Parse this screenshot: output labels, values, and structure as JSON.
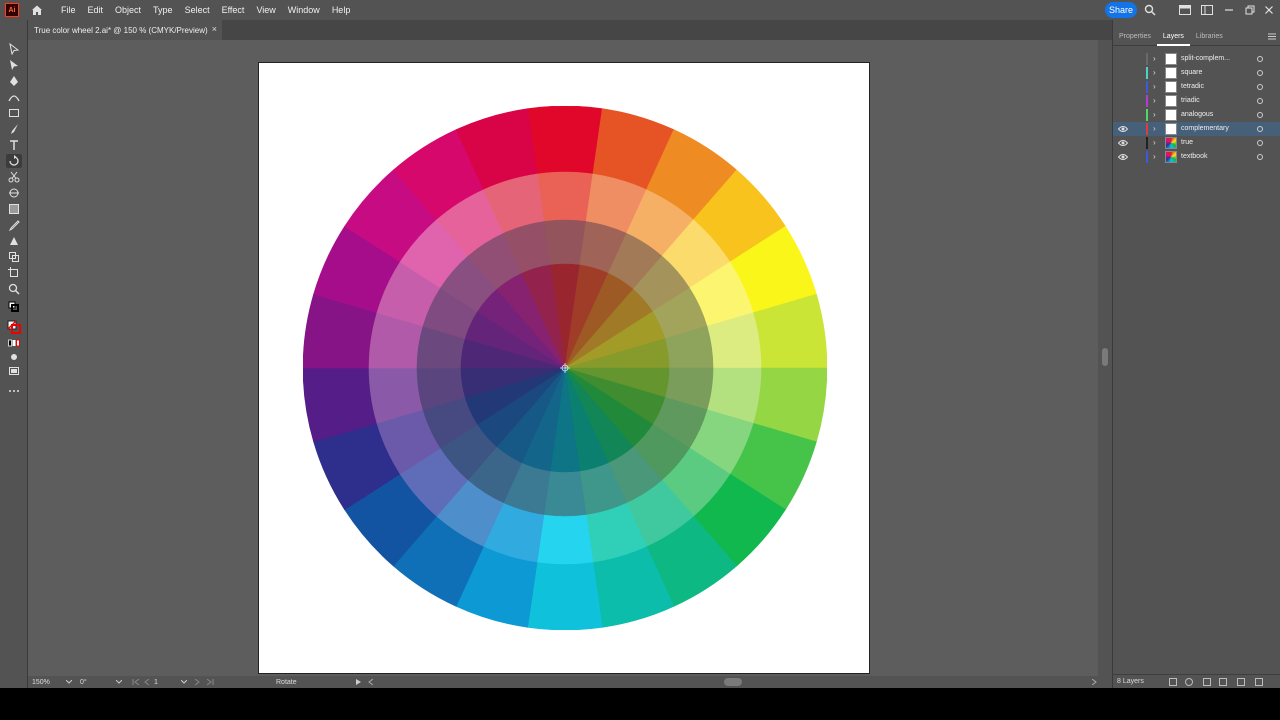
{
  "app": {
    "logo_text": "Ai",
    "menu": [
      "File",
      "Edit",
      "Object",
      "Type",
      "Select",
      "Effect",
      "View",
      "Window",
      "Help"
    ],
    "share_label": "Share"
  },
  "document": {
    "tab_title": "True color wheel 2.ai* @ 150 % (CMYK/Preview)",
    "close_glyph": "×"
  },
  "statusbar": {
    "zoom": "150%",
    "rotation": "0°",
    "artboard_number": "1",
    "tool_name": "Rotate"
  },
  "panel": {
    "tabs": [
      "Properties",
      "Layers",
      "Libraries"
    ],
    "active_tab": "Layers",
    "layers": [
      {
        "name": "split-complem...",
        "color": "#6a6a6a",
        "visible": false,
        "thumb": "blank",
        "selected": false
      },
      {
        "name": "square",
        "color": "#4fd1c5",
        "visible": false,
        "thumb": "blank",
        "selected": false
      },
      {
        "name": "tetradic",
        "color": "#3b5bdb",
        "visible": false,
        "thumb": "blank",
        "selected": false
      },
      {
        "name": "triadic",
        "color": "#b13ccf",
        "visible": false,
        "thumb": "blank",
        "selected": false
      },
      {
        "name": "analogous",
        "color": "#4cd964",
        "visible": false,
        "thumb": "blank",
        "selected": false
      },
      {
        "name": "complementary",
        "color": "#e03c3c",
        "visible": true,
        "thumb": "blank",
        "selected": true
      },
      {
        "name": "true",
        "color": "#222222",
        "visible": true,
        "thumb": "wheel",
        "selected": false
      },
      {
        "name": "textbook",
        "color": "#3b5bdb",
        "visible": true,
        "thumb": "wheel",
        "selected": false
      }
    ],
    "footer_label": "8 Layers"
  },
  "color_wheel": {
    "outer_ring": [
      "#e0072b",
      "#e65425",
      "#ef8b23",
      "#f7c31c",
      "#fbf61a",
      "#cbe536",
      "#94d643",
      "#46c449",
      "#10b84e",
      "#0db882",
      "#0cbdac",
      "#10c1dc",
      "#0d99d4",
      "#0f70b7",
      "#1354a2",
      "#2e2e8c",
      "#551d87",
      "#861487",
      "#a60d8a",
      "#c70b83",
      "#d6086c",
      "#d90448"
    ],
    "middle_ring": [
      "#e96255",
      "#ef8d63",
      "#f6b066",
      "#fadb6c",
      "#fbf56f",
      "#dcec80",
      "#b4e17f",
      "#86d57f",
      "#5acb80",
      "#40c99e",
      "#2fd0b7",
      "#25d4ee",
      "#30aadf",
      "#4e8fcb",
      "#5f6db8",
      "#6b5aa9",
      "#8a5aa8",
      "#b05aa9",
      "#c65eab",
      "#e063ad",
      "#e5639a",
      "#e66478"
    ],
    "inner_ring": [
      "#94545b",
      "#a06357",
      "#a27a57",
      "#a4935a",
      "#a2a45c",
      "#8ea35b",
      "#7a9d5c",
      "#60995e",
      "#4f995f",
      "#4a9779",
      "#3f968a",
      "#3a8a96",
      "#3c7a93",
      "#3b668a",
      "#3c5583",
      "#474a80",
      "#5a457e",
      "#6b487e",
      "#7f4b81",
      "#8a4f81",
      "#924f75",
      "#955068"
    ],
    "core": [
      "#99262f",
      "#a03d28",
      "#9e5a25",
      "#a07a26",
      "#a29b28",
      "#879a2c",
      "#64952f",
      "#3f8d30",
      "#208a3a",
      "#128656",
      "#0b8070",
      "#0d7586",
      "#13668a",
      "#175986",
      "#1c4880",
      "#233877",
      "#372e75",
      "#4e2876",
      "#642479",
      "#74227a",
      "#862270",
      "#93234d"
    ]
  }
}
